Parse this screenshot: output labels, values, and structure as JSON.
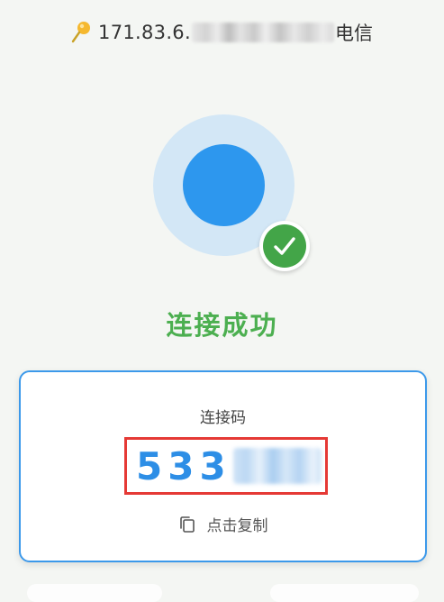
{
  "connection": {
    "ip_prefix": "171.83.6.",
    "carrier": "电信",
    "icon": "location-pin-icon"
  },
  "status": {
    "title": "连接成功",
    "icon": "check-icon",
    "colors": {
      "ring": "#d3e7f6",
      "dot": "#2d97ee",
      "success": "#43a548"
    }
  },
  "code_card": {
    "label": "连接码",
    "code_visible": "533",
    "copy_label": "点击复制",
    "copy_icon": "copy-icon",
    "accent": "#3c99ea",
    "highlight": "#e53935"
  }
}
